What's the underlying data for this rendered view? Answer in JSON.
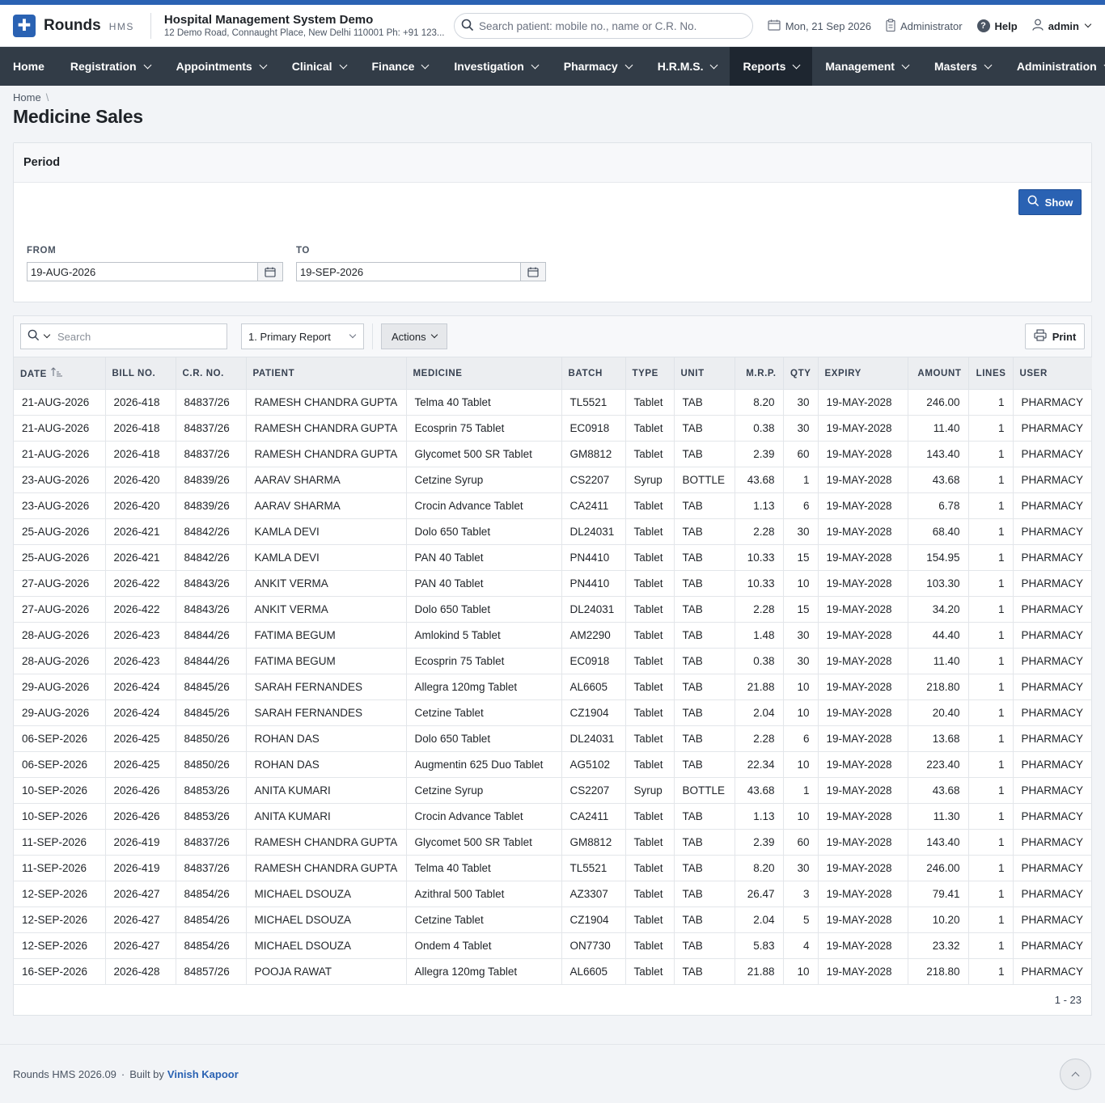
{
  "app": {
    "brand": "Rounds",
    "brand_sub": "HMS",
    "hospital_name": "Hospital Management System Demo",
    "hospital_address": "12 Demo Road, Connaught Place, New Delhi 110001 Ph: +91 123...",
    "accent_color": "#2a62b3"
  },
  "header": {
    "search_placeholder": "Search patient: mobile no., name or C.R. No.",
    "date": "Mon, 21 Sep 2026",
    "role": "Administrator",
    "help": "Help",
    "user": "admin"
  },
  "nav": {
    "items": [
      {
        "label": "Home"
      },
      {
        "label": "Registration"
      },
      {
        "label": "Appointments"
      },
      {
        "label": "Clinical"
      },
      {
        "label": "Finance"
      },
      {
        "label": "Investigation"
      },
      {
        "label": "Pharmacy"
      },
      {
        "label": "H.R.M.S."
      },
      {
        "label": "Reports",
        "active": true
      },
      {
        "label": "Management"
      },
      {
        "label": "Masters"
      },
      {
        "label": "Administration"
      }
    ]
  },
  "breadcrumb": {
    "home": "Home"
  },
  "page": {
    "title": "Medicine Sales"
  },
  "period": {
    "title": "Period",
    "show_button": "Show",
    "from_label": "FROM",
    "from_value": "19-AUG-2026",
    "to_label": "TO",
    "to_value": "19-SEP-2026"
  },
  "toolbar": {
    "search_placeholder": "Search",
    "report_select": "1. Primary Report",
    "actions": "Actions",
    "print": "Print"
  },
  "table": {
    "columns": [
      "DATE",
      "BILL NO.",
      "C.R. NO.",
      "PATIENT",
      "MEDICINE",
      "BATCH",
      "TYPE",
      "UNIT",
      "M.R.P.",
      "QTY",
      "EXPIRY",
      "AMOUNT",
      "LINES",
      "USER"
    ],
    "rows": [
      [
        "21-AUG-2026",
        "2026-418",
        "84837/26",
        "RAMESH CHANDRA GUPTA",
        "Telma 40 Tablet",
        "TL5521",
        "Tablet",
        "TAB",
        "8.20",
        "30",
        "19-MAY-2028",
        "246.00",
        "1",
        "PHARMACY"
      ],
      [
        "21-AUG-2026",
        "2026-418",
        "84837/26",
        "RAMESH CHANDRA GUPTA",
        "Ecosprin 75 Tablet",
        "EC0918",
        "Tablet",
        "TAB",
        "0.38",
        "30",
        "19-MAY-2028",
        "11.40",
        "1",
        "PHARMACY"
      ],
      [
        "21-AUG-2026",
        "2026-418",
        "84837/26",
        "RAMESH CHANDRA GUPTA",
        "Glycomet 500 SR Tablet",
        "GM8812",
        "Tablet",
        "TAB",
        "2.39",
        "60",
        "19-MAY-2028",
        "143.40",
        "1",
        "PHARMACY"
      ],
      [
        "23-AUG-2026",
        "2026-420",
        "84839/26",
        "AARAV SHARMA",
        "Cetzine Syrup",
        "CS2207",
        "Syrup",
        "BOTTLE",
        "43.68",
        "1",
        "19-MAY-2028",
        "43.68",
        "1",
        "PHARMACY"
      ],
      [
        "23-AUG-2026",
        "2026-420",
        "84839/26",
        "AARAV SHARMA",
        "Crocin Advance Tablet",
        "CA2411",
        "Tablet",
        "TAB",
        "1.13",
        "6",
        "19-MAY-2028",
        "6.78",
        "1",
        "PHARMACY"
      ],
      [
        "25-AUG-2026",
        "2026-421",
        "84842/26",
        "KAMLA DEVI",
        "Dolo 650 Tablet",
        "DL24031",
        "Tablet",
        "TAB",
        "2.28",
        "30",
        "19-MAY-2028",
        "68.40",
        "1",
        "PHARMACY"
      ],
      [
        "25-AUG-2026",
        "2026-421",
        "84842/26",
        "KAMLA DEVI",
        "PAN 40 Tablet",
        "PN4410",
        "Tablet",
        "TAB",
        "10.33",
        "15",
        "19-MAY-2028",
        "154.95",
        "1",
        "PHARMACY"
      ],
      [
        "27-AUG-2026",
        "2026-422",
        "84843/26",
        "ANKIT VERMA",
        "PAN 40 Tablet",
        "PN4410",
        "Tablet",
        "TAB",
        "10.33",
        "10",
        "19-MAY-2028",
        "103.30",
        "1",
        "PHARMACY"
      ],
      [
        "27-AUG-2026",
        "2026-422",
        "84843/26",
        "ANKIT VERMA",
        "Dolo 650 Tablet",
        "DL24031",
        "Tablet",
        "TAB",
        "2.28",
        "15",
        "19-MAY-2028",
        "34.20",
        "1",
        "PHARMACY"
      ],
      [
        "28-AUG-2026",
        "2026-423",
        "84844/26",
        "FATIMA BEGUM",
        "Amlokind 5 Tablet",
        "AM2290",
        "Tablet",
        "TAB",
        "1.48",
        "30",
        "19-MAY-2028",
        "44.40",
        "1",
        "PHARMACY"
      ],
      [
        "28-AUG-2026",
        "2026-423",
        "84844/26",
        "FATIMA BEGUM",
        "Ecosprin 75 Tablet",
        "EC0918",
        "Tablet",
        "TAB",
        "0.38",
        "30",
        "19-MAY-2028",
        "11.40",
        "1",
        "PHARMACY"
      ],
      [
        "29-AUG-2026",
        "2026-424",
        "84845/26",
        "SARAH FERNANDES",
        "Allegra 120mg Tablet",
        "AL6605",
        "Tablet",
        "TAB",
        "21.88",
        "10",
        "19-MAY-2028",
        "218.80",
        "1",
        "PHARMACY"
      ],
      [
        "29-AUG-2026",
        "2026-424",
        "84845/26",
        "SARAH FERNANDES",
        "Cetzine Tablet",
        "CZ1904",
        "Tablet",
        "TAB",
        "2.04",
        "10",
        "19-MAY-2028",
        "20.40",
        "1",
        "PHARMACY"
      ],
      [
        "06-SEP-2026",
        "2026-425",
        "84850/26",
        "ROHAN DAS",
        "Dolo 650 Tablet",
        "DL24031",
        "Tablet",
        "TAB",
        "2.28",
        "6",
        "19-MAY-2028",
        "13.68",
        "1",
        "PHARMACY"
      ],
      [
        "06-SEP-2026",
        "2026-425",
        "84850/26",
        "ROHAN DAS",
        "Augmentin 625 Duo Tablet",
        "AG5102",
        "Tablet",
        "TAB",
        "22.34",
        "10",
        "19-MAY-2028",
        "223.40",
        "1",
        "PHARMACY"
      ],
      [
        "10-SEP-2026",
        "2026-426",
        "84853/26",
        "ANITA KUMARI",
        "Cetzine Syrup",
        "CS2207",
        "Syrup",
        "BOTTLE",
        "43.68",
        "1",
        "19-MAY-2028",
        "43.68",
        "1",
        "PHARMACY"
      ],
      [
        "10-SEP-2026",
        "2026-426",
        "84853/26",
        "ANITA KUMARI",
        "Crocin Advance Tablet",
        "CA2411",
        "Tablet",
        "TAB",
        "1.13",
        "10",
        "19-MAY-2028",
        "11.30",
        "1",
        "PHARMACY"
      ],
      [
        "11-SEP-2026",
        "2026-419",
        "84837/26",
        "RAMESH CHANDRA GUPTA",
        "Glycomet 500 SR Tablet",
        "GM8812",
        "Tablet",
        "TAB",
        "2.39",
        "60",
        "19-MAY-2028",
        "143.40",
        "1",
        "PHARMACY"
      ],
      [
        "11-SEP-2026",
        "2026-419",
        "84837/26",
        "RAMESH CHANDRA GUPTA",
        "Telma 40 Tablet",
        "TL5521",
        "Tablet",
        "TAB",
        "8.20",
        "30",
        "19-MAY-2028",
        "246.00",
        "1",
        "PHARMACY"
      ],
      [
        "12-SEP-2026",
        "2026-427",
        "84854/26",
        "MICHAEL DSOUZA",
        "Azithral 500 Tablet",
        "AZ3307",
        "Tablet",
        "TAB",
        "26.47",
        "3",
        "19-MAY-2028",
        "79.41",
        "1",
        "PHARMACY"
      ],
      [
        "12-SEP-2026",
        "2026-427",
        "84854/26",
        "MICHAEL DSOUZA",
        "Cetzine Tablet",
        "CZ1904",
        "Tablet",
        "TAB",
        "2.04",
        "5",
        "19-MAY-2028",
        "10.20",
        "1",
        "PHARMACY"
      ],
      [
        "12-SEP-2026",
        "2026-427",
        "84854/26",
        "MICHAEL DSOUZA",
        "Ondem 4 Tablet",
        "ON7730",
        "Tablet",
        "TAB",
        "5.83",
        "4",
        "19-MAY-2028",
        "23.32",
        "1",
        "PHARMACY"
      ],
      [
        "16-SEP-2026",
        "2026-428",
        "84857/26",
        "POOJA RAWAT",
        "Allegra 120mg Tablet",
        "AL6605",
        "Tablet",
        "TAB",
        "21.88",
        "10",
        "19-MAY-2028",
        "218.80",
        "1",
        "PHARMACY"
      ]
    ],
    "pager": "1 - 23"
  },
  "footer": {
    "version": "Rounds HMS 2026.09",
    "dot": "·",
    "built_by": "Built by",
    "author": "Vinish Kapoor"
  }
}
